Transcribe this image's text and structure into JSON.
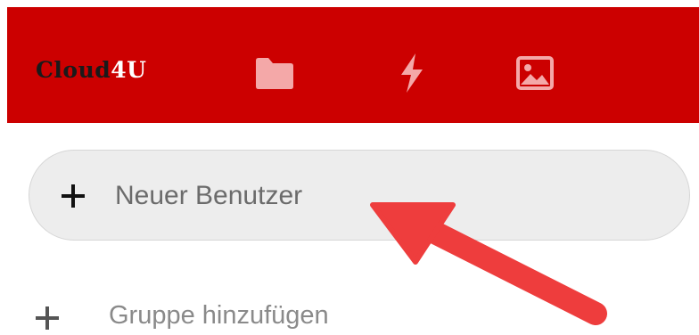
{
  "header": {
    "logo_text": "Cloud",
    "logo_accent": "4U",
    "background_color": "#cc0000",
    "nav": [
      {
        "icon": "folder-icon",
        "name": "Files"
      },
      {
        "icon": "lightning-icon",
        "name": "Activity"
      },
      {
        "icon": "image-icon",
        "name": "Gallery"
      }
    ]
  },
  "sidebar": {
    "new_user_label": "Neuer Benutzer",
    "add_group_label": "Gruppe hinzufügen"
  },
  "annotation": {
    "arrow_color": "#ee3d3d",
    "points_to": "new-user-button"
  }
}
